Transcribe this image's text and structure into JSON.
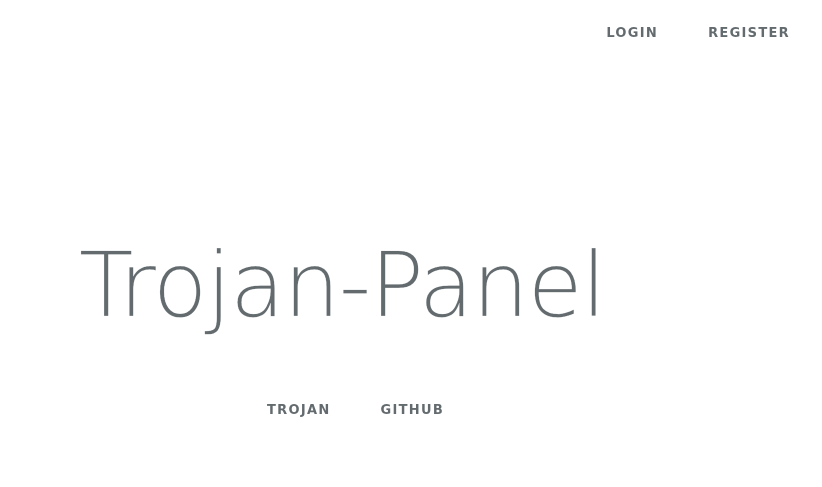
{
  "nav": {
    "login_label": "LOGIN",
    "register_label": "REGISTER"
  },
  "hero": {
    "title": "Trojan-Panel"
  },
  "links": [
    {
      "label": "TROJAN"
    },
    {
      "label": "GITHUB"
    }
  ],
  "colors": {
    "text": "#636b6f",
    "background": "#ffffff"
  }
}
